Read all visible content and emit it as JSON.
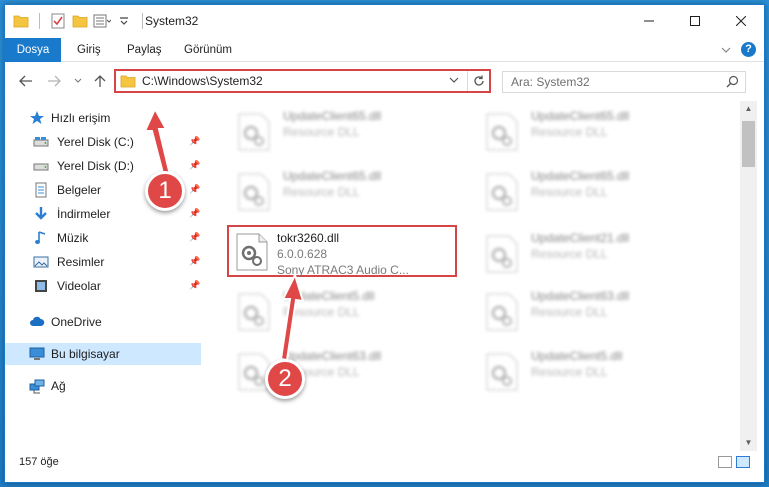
{
  "window": {
    "title": "System32"
  },
  "ribbon": {
    "tabs": [
      "Dosya",
      "Giriş",
      "Paylaş",
      "Görünüm"
    ]
  },
  "address": {
    "path": "C:\\Windows\\System32",
    "search_placeholder": "Ara: System32"
  },
  "sidebar": {
    "items": [
      {
        "label": "Hızlı erişim",
        "icon": "star-icon"
      },
      {
        "label": "Yerel Disk (C:)",
        "icon": "drive-icon",
        "pinned": true
      },
      {
        "label": "Yerel Disk (D:)",
        "icon": "drive-icon",
        "pinned": true
      },
      {
        "label": "Belgeler",
        "icon": "documents-icon",
        "pinned": true
      },
      {
        "label": "İndirmeler",
        "icon": "download-icon",
        "pinned": true
      },
      {
        "label": "Müzik",
        "icon": "music-icon",
        "pinned": true
      },
      {
        "label": "Resimler",
        "icon": "pictures-icon",
        "pinned": true
      },
      {
        "label": "Videolar",
        "icon": "videos-icon",
        "pinned": true
      },
      {
        "label": "OneDrive",
        "icon": "cloud-icon"
      },
      {
        "label": "Bu bilgisayar",
        "icon": "computer-icon",
        "selected": true
      },
      {
        "label": "Ağ",
        "icon": "network-icon"
      }
    ]
  },
  "files": [
    {
      "name": "UpdateClient65.dll",
      "type": "Resource DLL",
      "blurred": true
    },
    {
      "name": "UpdateClient65.dll",
      "type": "Resource DLL",
      "blurred": true
    },
    {
      "name": "UpdateClient65.dll",
      "type": "Resource DLL",
      "blurred": true
    },
    {
      "name": "UpdateClient65.dll",
      "type": "Resource DLL",
      "blurred": true
    },
    {
      "name": "tokr3260.dll",
      "version": "6.0.0.628",
      "type": "Sony ATRAC3 Audio C...",
      "blurred": false,
      "highlighted": true
    },
    {
      "name": "UpdateClient21.dll",
      "type": "Resource DLL",
      "blurred": true
    },
    {
      "name": "UpdateClient5.dll",
      "type": "Resource DLL",
      "blurred": true
    },
    {
      "name": "UpdateClient63.dll",
      "type": "Resource DLL",
      "blurred": true
    },
    {
      "name": "UpdateClient63.dll",
      "type": "Resource DLL",
      "blurred": true
    },
    {
      "name": "UpdateClient5.dll",
      "type": "Resource DLL",
      "blurred": true
    }
  ],
  "status": {
    "item_count": "157 öğe"
  },
  "callouts": [
    "1",
    "2"
  ],
  "colors": {
    "accent": "#1979ca",
    "highlight": "#d64545",
    "callout": "#e04848",
    "selected": "#cde8ff"
  }
}
